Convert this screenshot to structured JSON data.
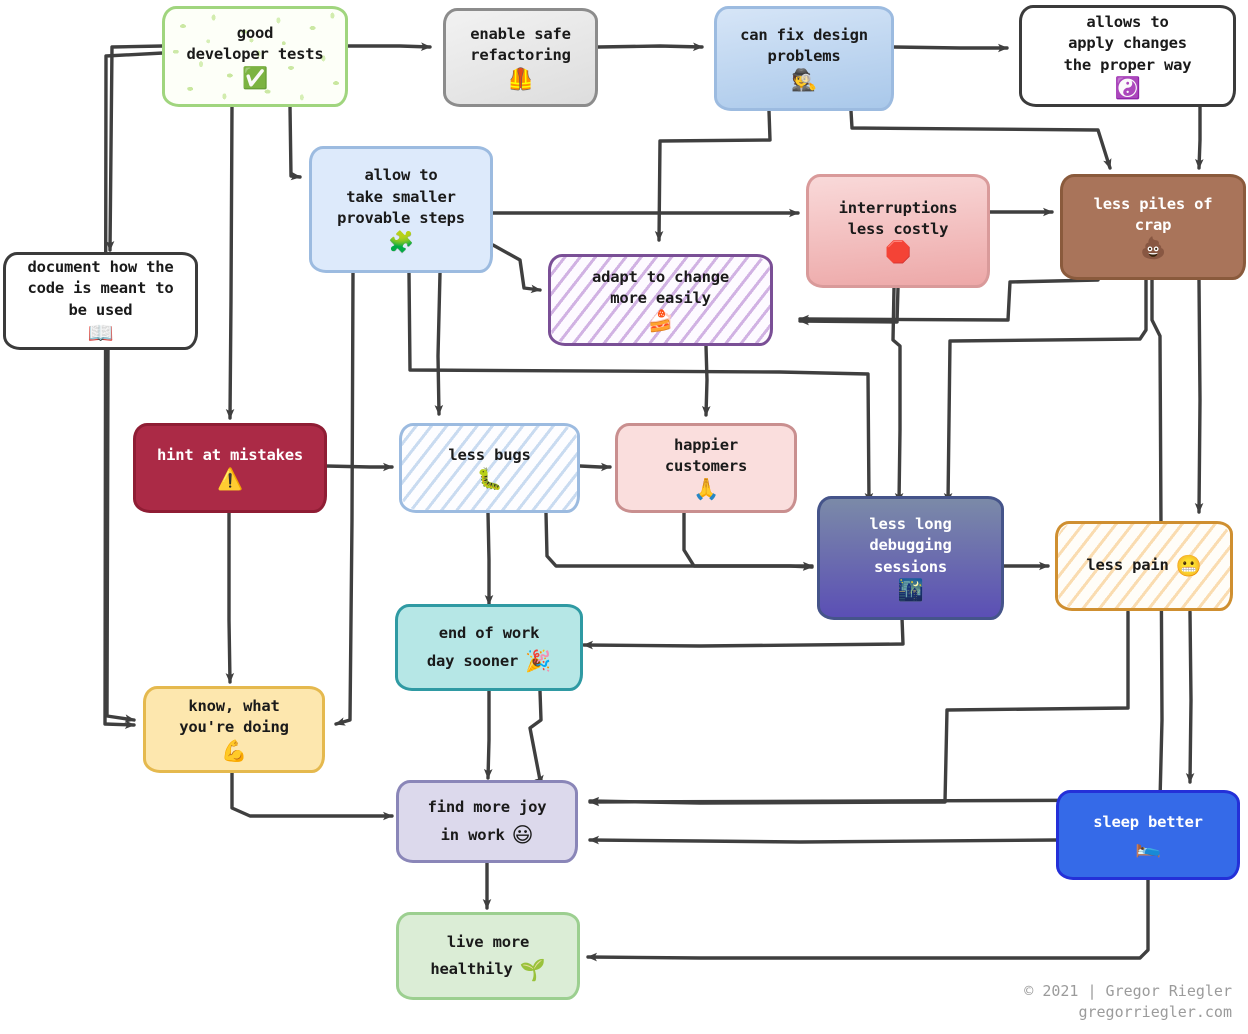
{
  "diagram": {
    "title": "good developer tests benefits flowchart",
    "nodes": [
      {
        "id": "good_tests",
        "label": "good\ndeveloper tests",
        "emoji": "✅",
        "emoji_name": "white-check-mark-icon"
      },
      {
        "id": "enable_safe",
        "label": "enable safe\nrefactoring",
        "emoji": "🦺",
        "emoji_name": "safety-vest-icon"
      },
      {
        "id": "can_fix",
        "label": "can fix design\nproblems",
        "emoji": "🕵️",
        "emoji_name": "detective-icon"
      },
      {
        "id": "allows_apply",
        "label": "allows to\napply changes\nthe proper way",
        "emoji": "☯️",
        "emoji_name": "yin-yang-icon"
      },
      {
        "id": "allow_steps",
        "label": "allow to\ntake smaller\nprovable steps",
        "emoji": "🧩",
        "emoji_name": "puzzle-piece-icon"
      },
      {
        "id": "document",
        "label": "document how the\ncode is meant to\nbe used",
        "emoji": "📖",
        "emoji_name": "open-book-icon"
      },
      {
        "id": "interruptions",
        "label": "interruptions\nless costly",
        "emoji": "🛑",
        "emoji_name": "stop-sign-icon"
      },
      {
        "id": "less_piles",
        "label": "less piles of\ncrap",
        "emoji": "💩",
        "emoji_name": "poop-icon"
      },
      {
        "id": "adapt",
        "label": "adapt to change\nmore easily",
        "emoji": "🍰",
        "emoji_name": "shortcake-icon"
      },
      {
        "id": "hint",
        "label": "hint at mistakes",
        "emoji": "⚠️",
        "emoji_name": "warning-icon"
      },
      {
        "id": "less_bugs",
        "label": "less bugs",
        "emoji": "🐛",
        "emoji_name": "bug-icon"
      },
      {
        "id": "happier",
        "label": "happier\ncustomers",
        "emoji": "🙏",
        "emoji_name": "folded-hands-icon"
      },
      {
        "id": "less_debug",
        "label": "less long\ndebugging\nsessions",
        "emoji": "🌃",
        "emoji_name": "night-city-icon"
      },
      {
        "id": "less_pain",
        "label": "less pain",
        "emoji": "😬",
        "emoji_name": "grimacing-face-icon"
      },
      {
        "id": "end_work",
        "label": "end of work\nday sooner",
        "emoji": "🎉",
        "emoji_name": "party-popper-icon"
      },
      {
        "id": "know",
        "label": "know, what\nyou're doing",
        "emoji": "💪",
        "emoji_name": "flexed-biceps-icon"
      },
      {
        "id": "joy",
        "label": "find more joy\nin work",
        "emoji": "😃",
        "emoji_name": "grinning-face-icon"
      },
      {
        "id": "sleep",
        "label": "sleep better",
        "emoji": "🛌",
        "emoji_name": "person-in-bed-icon"
      },
      {
        "id": "live",
        "label": "live more\nhealthily",
        "emoji": "🌱",
        "emoji_name": "seedling-icon"
      }
    ],
    "edges": [
      {
        "from": "good_tests",
        "to": "enable_safe"
      },
      {
        "from": "good_tests",
        "to": "document"
      },
      {
        "from": "good_tests",
        "to": "hint"
      },
      {
        "from": "good_tests",
        "to": "allow_steps"
      },
      {
        "from": "good_tests",
        "to": "know"
      },
      {
        "from": "enable_safe",
        "to": "can_fix"
      },
      {
        "from": "can_fix",
        "to": "allows_apply"
      },
      {
        "from": "can_fix",
        "to": "adapt"
      },
      {
        "from": "can_fix",
        "to": "less_piles"
      },
      {
        "from": "allows_apply",
        "to": "less_piles"
      },
      {
        "from": "allow_steps",
        "to": "interruptions"
      },
      {
        "from": "allow_steps",
        "to": "adapt"
      },
      {
        "from": "allow_steps",
        "to": "less_bugs"
      },
      {
        "from": "allow_steps",
        "to": "know"
      },
      {
        "from": "allow_steps",
        "to": "less_debug"
      },
      {
        "from": "document",
        "to": "know"
      },
      {
        "from": "interruptions",
        "to": "less_piles"
      },
      {
        "from": "interruptions",
        "to": "adapt"
      },
      {
        "from": "interruptions",
        "to": "less_debug"
      },
      {
        "from": "less_piles",
        "to": "adapt"
      },
      {
        "from": "less_piles",
        "to": "less_pain"
      },
      {
        "from": "less_piles",
        "to": "less_debug"
      },
      {
        "from": "less_piles",
        "to": "joy"
      },
      {
        "from": "adapt",
        "to": "happier"
      },
      {
        "from": "hint",
        "to": "less_bugs"
      },
      {
        "from": "hint",
        "to": "know"
      },
      {
        "from": "less_bugs",
        "to": "happier"
      },
      {
        "from": "less_bugs",
        "to": "end_work"
      },
      {
        "from": "less_bugs",
        "to": "less_debug"
      },
      {
        "from": "happier",
        "to": "less_debug"
      },
      {
        "from": "less_debug",
        "to": "less_pain"
      },
      {
        "from": "less_debug",
        "to": "end_work"
      },
      {
        "from": "less_pain",
        "to": "sleep"
      },
      {
        "from": "less_pain",
        "to": "joy"
      },
      {
        "from": "end_work",
        "to": "joy"
      },
      {
        "from": "know",
        "to": "joy"
      },
      {
        "from": "joy",
        "to": "live"
      },
      {
        "from": "sleep",
        "to": "joy"
      },
      {
        "from": "sleep",
        "to": "live"
      }
    ]
  },
  "footer": {
    "line1": "© 2021 | Gregor Riegler",
    "line2": "gregorriegler.com"
  },
  "colors": {
    "edge": "#3f3f3f",
    "good_tests": "#a0d57e",
    "enable_safe": "#8c8c8c",
    "can_fix": "#9cbbe0",
    "allows_apply": "#3b3b3b",
    "allow_steps": "#9cbbe0",
    "document": "#3b3b3b",
    "interruptions": "#d99a9a",
    "less_piles": "#a9745a",
    "adapt": "#7a4f96",
    "hint": "#ab2a46",
    "less_bugs": "#9cbbe0",
    "happier": "#c98f8f",
    "less_debug": "#5b4fb5",
    "less_pain": "#cf8f30",
    "end_work": "#2f9aa3",
    "know": "#e5b94e",
    "joy": "#8a86b8",
    "sleep": "#356ae8",
    "live": "#9ccf90",
    "footer_text": "#9b9b9b"
  }
}
